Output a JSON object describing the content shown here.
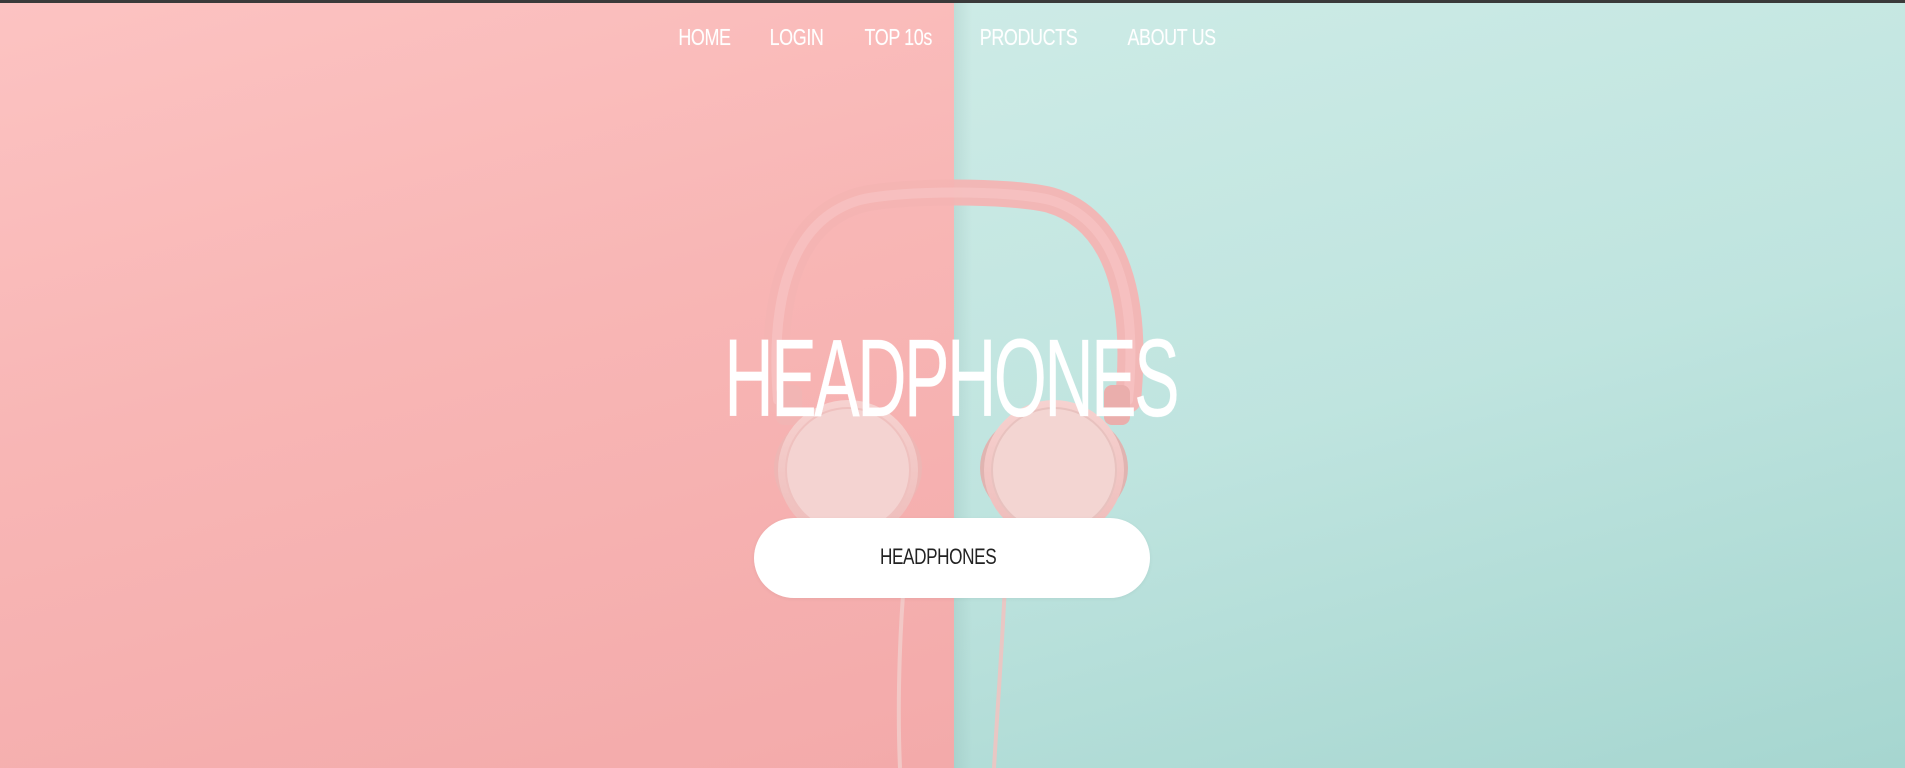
{
  "nav": {
    "items": [
      {
        "label": "HOME"
      },
      {
        "label": "LOGIN"
      },
      {
        "label": "TOP 10s"
      },
      {
        "label": "PRODUCTS"
      },
      {
        "label": "ABOUT US"
      }
    ]
  },
  "hero": {
    "title": "HEADPHONES",
    "button_label": "HEADPHONES",
    "image_icon": "headphones-illustration"
  },
  "colors": {
    "left_background": "#f8b6b5",
    "right_background": "#bfe4df",
    "text": "#ffffff",
    "button_bg": "#ffffff",
    "button_text": "#222222"
  }
}
